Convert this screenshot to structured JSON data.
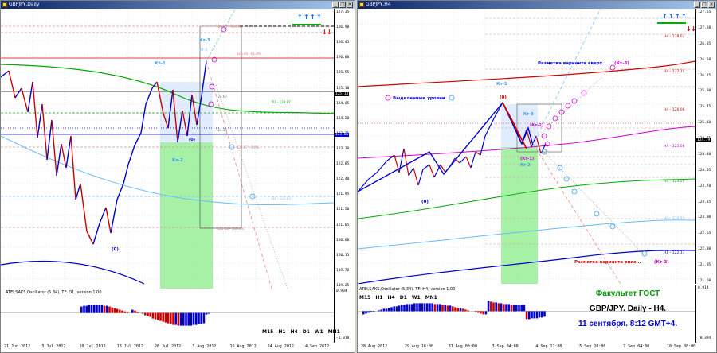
{
  "left_window": {
    "title": "GBPJPY,Daily",
    "price_labels": [
      "127.35",
      "126.90",
      "126.45",
      "126.00",
      "125.55",
      "125.10",
      "124.65",
      "124.20",
      "123.75",
      "123.30",
      "122.85",
      "122.40",
      "121.95",
      "121.50",
      "121.05",
      "120.60",
      "120.15",
      "119.70",
      "119.25"
    ],
    "current_price": "125.13",
    "level_price": "123.85",
    "dates": [
      "21 Jun 2012",
      "3 Jul 2012",
      "10 Jul 2012",
      "18 Jul 2012",
      "26 Jul 2012",
      "3 Aug 2012",
      "16 Aug 2012",
      "24 Aug 2012",
      "4 Sep 2012"
    ],
    "wave_labels": {
      "kt1": "Кт-1",
      "kt2": "Кт-2",
      "kt3": "Кт-3",
      "kt1b": "Кт-1",
      "zero_a": "(0)",
      "zero_b": "(0)"
    },
    "level_texts": {
      "l1": "126.73 - 76.4%",
      "l2": "126.40 - 61.8%",
      "l3": "124.67",
      "l4": "124.35",
      "l5": "123.67 - 0.0%",
      "l6": "121.38 - 100.0%",
      "l7": "D1 - 124.87",
      "l8": "D1 - 122.13"
    },
    "osc_title": "ATEI,SAKS,Oscillator (5,34), TF: D1, version 1.00",
    "osc_values": [
      "0.904",
      "-1.018"
    ],
    "timeframes": [
      "M15",
      "H1",
      "H4",
      "D1",
      "W1",
      "MN1"
    ]
  },
  "right_window": {
    "title": "GBPJPY,H4",
    "price_labels": [
      "127.55",
      "127.20",
      "126.85",
      "126.50",
      "126.15",
      "125.80",
      "125.45",
      "125.10",
      "124.75",
      "124.40",
      "124.05",
      "123.70",
      "123.35",
      "123.00",
      "122.65",
      "122.30",
      "121.95",
      "121.60"
    ],
    "current_price": "124.79",
    "dates": [
      "28 Aug 2012",
      "29 Aug 16:00",
      "31 Aug 00:00",
      "3 Sep 04:00",
      "4 Sep 12:00",
      "5 Sep 20:00",
      "7 Sep 04:00",
      "10 Sep 08:00"
    ],
    "wave_labels": {
      "kt1": "Кт-1",
      "kt0": "Кт-0",
      "kt2a": "(Кт-2)",
      "kt1b": "(Кт-1)",
      "kt2": "Кт-2",
      "zero_a": "(0)",
      "zero_b": "(0)",
      "kt3": "(Кт-3)",
      "kt3b": "(Кт-3)"
    },
    "legend_text": "Выделенные уровни",
    "markup_up": "Разметка варианта вверх...",
    "markup_down": "Разметка варианта вниз...",
    "level_texts": {
      "h1": "H4 - 128.03",
      "h2": "H4 - 127.15",
      "h3": "H4 - 126.06",
      "h4": "H4 - 125.08",
      "h5": "H4 - 123.50",
      "h6": "H4 - 123.11",
      "h7": "H1 - 122.13"
    },
    "osc_title": "ATEI,SAKS,Oscillator (5,34), TF: H4, version 1.00",
    "osc_values": [
      "0.914",
      "-0.394"
    ],
    "timeframes": [
      "M15",
      "H1",
      "H4",
      "D1",
      "W1",
      "MN1"
    ]
  },
  "caption": {
    "line1": "Факультет ГОСТ",
    "line2": "GBP/JPY. Daily - H4.",
    "line3": "11 сентября. 8:12 GMT+4."
  },
  "colors": {
    "bull": "#0000cc",
    "bear": "#cc0000",
    "ma_green": "#00aa00",
    "ma_red": "#cc0000",
    "ma_blue": "#0000cc",
    "ma_cyan": "#66bbff",
    "zone": "#90ee90",
    "magenta": "#cc00cc",
    "caption_green": "#009900",
    "caption_blue": "#0000cc"
  }
}
